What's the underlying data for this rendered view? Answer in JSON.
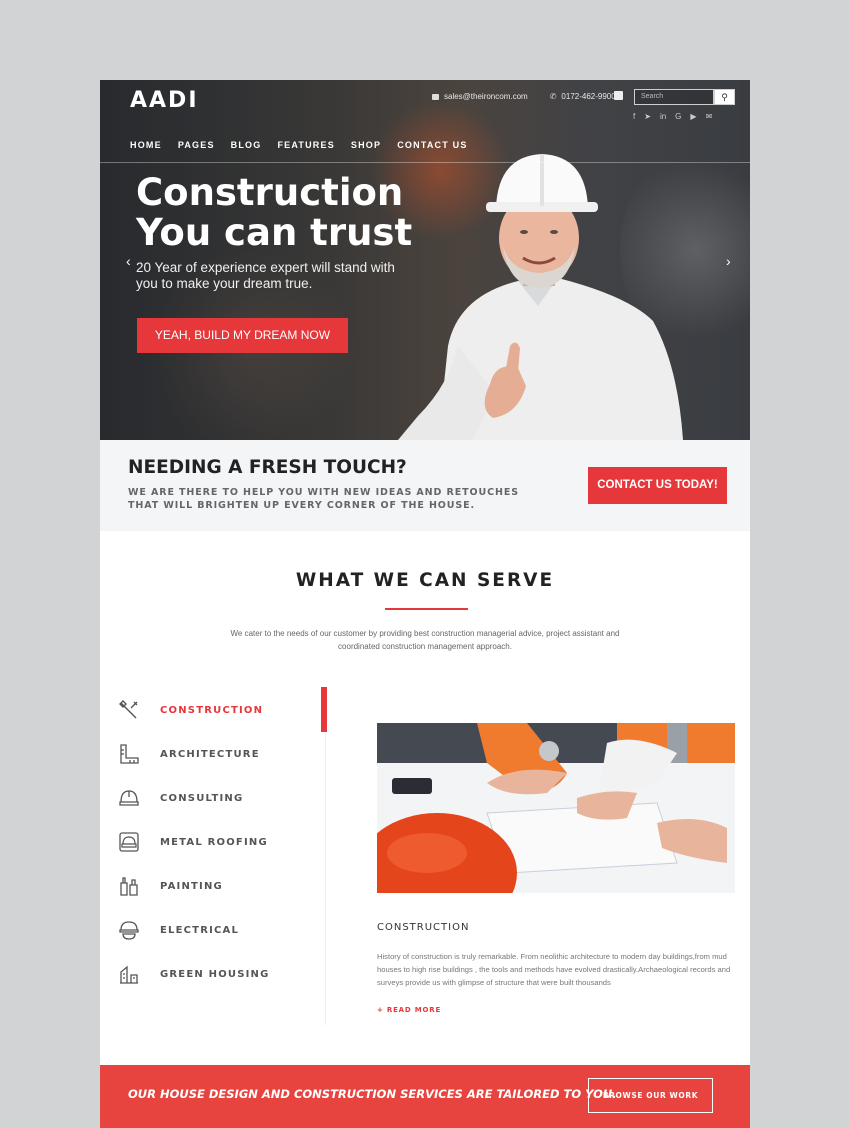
{
  "header": {
    "logo": "AADI",
    "email": "sales@theironcom.com",
    "phone": "0172-462-9900",
    "search_placeholder": "Search",
    "nav": [
      "HOME",
      "PAGES",
      "BLOG",
      "FEATURES",
      "SHOP",
      "CONTACT US"
    ]
  },
  "hero": {
    "title": "Construction You can trust",
    "subtitle": "20 Year of experience expert will stand with you to make your dream true.",
    "button": "YEAH, BUILD MY DREAM NOW"
  },
  "cta": {
    "title": "NEEDING A FRESH TOUCH?",
    "text": "WE ARE THERE TO HELP YOU WITH NEW IDEAS AND RETOUCHES THAT WILL BRIGHTEN UP EVERY CORNER OF THE HOUSE.",
    "button": "CONTACT US TODAY!"
  },
  "services": {
    "title": "WHAT WE CAN SERVE",
    "description": "We cater to the needs of our customer by providing best construction managerial advice, project assistant and coordinated construction management approach.",
    "items": [
      {
        "label": "CONSTRUCTION",
        "icon": "tools-icon"
      },
      {
        "label": "ARCHITECTURE",
        "icon": "ruler-icon"
      },
      {
        "label": "CONSULTING",
        "icon": "helmet-icon"
      },
      {
        "label": "METAL ROOFING",
        "icon": "roofing-icon"
      },
      {
        "label": "PAINTING",
        "icon": "paint-icon"
      },
      {
        "label": "ELECTRICAL",
        "icon": "electrical-icon"
      },
      {
        "label": "GREEN HOUSING",
        "icon": "green-housing-icon"
      }
    ],
    "detail": {
      "caption": "CONSTRUCTION",
      "text": "History of construction is truly remarkable.  From neolithic architecture to modern day buildings,from mud houses to high rise buildings , the tools and methods have evolved drastically.Archaeological records and  surveys provide us with glimpse of structure that were built thousands",
      "read_more": "+ READ MORE"
    }
  },
  "band": {
    "text": "OUR HOUSE DESIGN AND CONSTRUCTION SERVICES ARE TAILORED TO YOU.",
    "button": "BROWSE OUR WORK"
  },
  "colors": {
    "accent": "#e6373b",
    "band": "#e8443f"
  }
}
